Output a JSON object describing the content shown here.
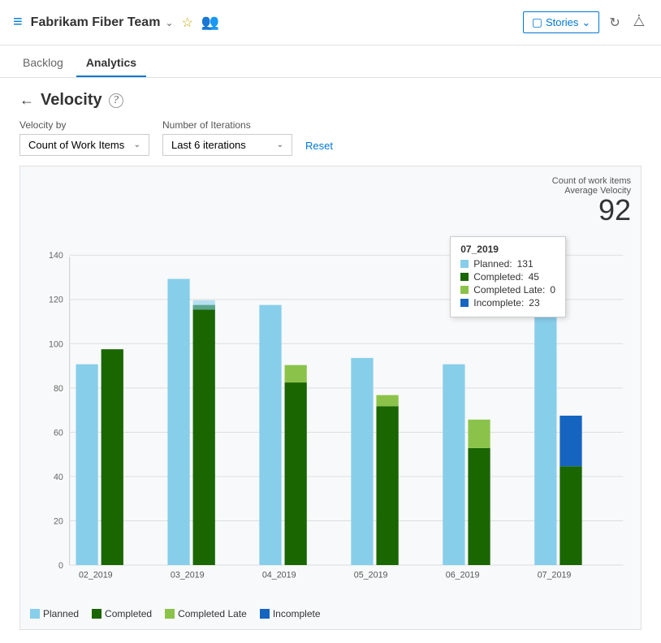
{
  "header": {
    "icon": "≡",
    "title": "Fabrikam Fiber Team",
    "chevron": "∨",
    "star": "☆",
    "people_icon": "👥",
    "stories_label": "Stories",
    "stories_chevron": "∨",
    "refresh_title": "Refresh",
    "expand_title": "Expand"
  },
  "nav": {
    "tabs": [
      {
        "label": "Backlog",
        "active": false
      },
      {
        "label": "Analytics",
        "active": true
      }
    ]
  },
  "page": {
    "title": "Velocity",
    "help_label": "?",
    "back_label": "←"
  },
  "controls": {
    "velocity_by_label": "Velocity by",
    "velocity_by_value": "Count of Work Items",
    "iterations_label": "Number of Iterations",
    "iterations_value": "Last 6 iterations",
    "reset_label": "Reset"
  },
  "chart": {
    "avg_label_line1": "Count of work items",
    "avg_label_line2": "Average Velocity",
    "avg_value": "92",
    "y_max": 140,
    "y_step": 20,
    "bars": [
      {
        "sprint": "02_2019",
        "planned": 91,
        "completed": 98,
        "completed_late": 0,
        "incomplete": 0
      },
      {
        "sprint": "03_2019",
        "planned": 130,
        "completed": 118,
        "completed_late": 0,
        "incomplete": 0
      },
      {
        "sprint": "04_2019",
        "planned": 118,
        "completed": 83,
        "completed_late": 8,
        "incomplete": 0
      },
      {
        "sprint": "05_2019",
        "planned": 94,
        "completed": 72,
        "completed_late": 5,
        "incomplete": 0
      },
      {
        "sprint": "06_2019",
        "planned": 91,
        "completed": 53,
        "completed_late": 13,
        "incomplete": 0
      },
      {
        "sprint": "07_2019",
        "planned": 131,
        "completed": 45,
        "completed_late": 0,
        "incomplete": 23
      }
    ],
    "tooltip": {
      "sprint": "07_2019",
      "planned_label": "Planned:",
      "planned_val": "131",
      "completed_label": "Completed:",
      "completed_val": "45",
      "completed_late_label": "Completed Late:",
      "completed_late_val": "0",
      "incomplete_label": "Incomplete:",
      "incomplete_val": "23"
    },
    "legend": [
      {
        "label": "Planned",
        "color": "#87ceeb"
      },
      {
        "label": "Completed",
        "color": "#1a6600"
      },
      {
        "label": "Completed Late",
        "color": "#8bc34a"
      },
      {
        "label": "Incomplete",
        "color": "#1565c0"
      }
    ],
    "colors": {
      "planned": "#87ceeb",
      "completed": "#1a6600",
      "completed_late": "#8bc34a",
      "incomplete": "#1565c0"
    }
  }
}
